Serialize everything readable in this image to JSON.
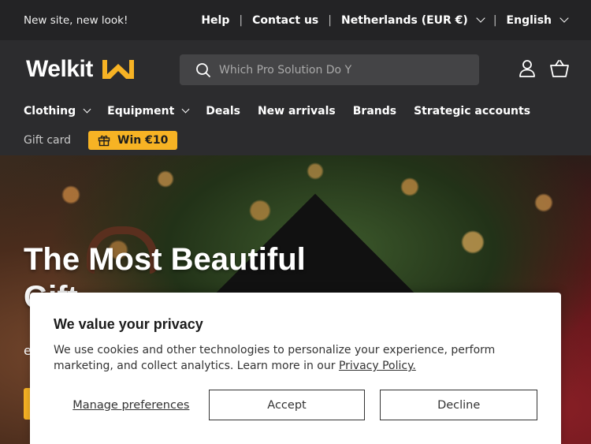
{
  "topbar": {
    "promo": "New site, new look!",
    "help": "Help",
    "contact": "Contact us",
    "region": "Netherlands (EUR €)",
    "language": "English"
  },
  "header": {
    "logo_text": "Welkit",
    "search_placeholder": "Which Pro Solution Do Y"
  },
  "nav": {
    "items": [
      "Clothing",
      "Equipment",
      "Deals",
      "New arrivals",
      "Brands",
      "Strategic accounts"
    ],
    "gift_card": "Gift card",
    "win_label": "Win €10"
  },
  "hero": {
    "title": "The Most Beautiful",
    "title_line2": "Gift",
    "sub_fragment": "e"
  },
  "cookie": {
    "title": "We value your privacy",
    "body": "We use cookies and other technologies to personalize your experience, perform marketing, and collect analytics. Learn more in our ",
    "policy_link": "Privacy Policy.",
    "manage": "Manage preferences",
    "accept": "Accept",
    "decline": "Decline"
  },
  "colors": {
    "accent": "#f7b324",
    "topbar_bg": "#232325",
    "header_bg": "#2c2c2e"
  }
}
